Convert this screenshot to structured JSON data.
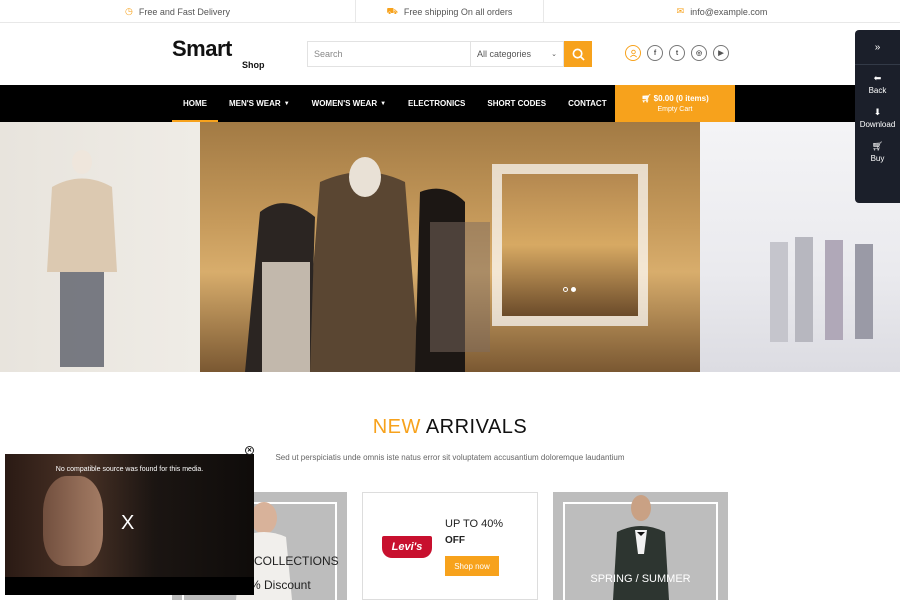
{
  "topbar": {
    "delivery": "Free and Fast Delivery",
    "shipping": "Free shipping On all orders",
    "email": "info@example.com"
  },
  "logo": {
    "main": "Smart",
    "sub": "Shop"
  },
  "search": {
    "placeholder": "Search",
    "category": "All categories"
  },
  "nav": {
    "items": [
      "HOME",
      "MEN'S WEAR",
      "WOMEN'S WEAR",
      "ELECTRONICS",
      "SHORT CODES",
      "CONTACT"
    ],
    "active": "HOME"
  },
  "cart": {
    "total": "$0.00 (0 items)",
    "status": "Empty Cart"
  },
  "arrivals": {
    "title_highlight": "NEW",
    "title_rest": "ARRIVALS",
    "subtitle": "Sed ut perspiciatis unde omnis iste natus error sit voluptatem accusantium doloremque laudantium"
  },
  "cards": {
    "card1_line1": "COLLECTIONS",
    "card1_line2": "% Discount",
    "brand": "Levi's",
    "card2_line1": "UP TO 40%",
    "card2_line2": "OFF",
    "card2_button": "Shop now",
    "card3_line": "SPRING / SUMMER"
  },
  "sidepanel": {
    "back": "Back",
    "download": "Download",
    "buy": "Buy"
  },
  "video": {
    "message": "No compatible source was found for this media.",
    "close_mark": "X"
  },
  "colors": {
    "accent": "#f7a21c",
    "nav_bg": "#000000",
    "panel_bg": "#1b1f2a"
  }
}
